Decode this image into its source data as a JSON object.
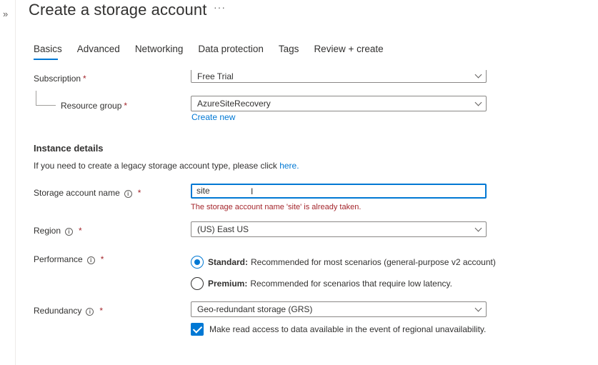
{
  "title": "Create a storage account",
  "more_icon": "ellipsis-icon",
  "expand_icon": "double-chevron-right-icon",
  "tabs": [
    {
      "label": "Basics",
      "active": true
    },
    {
      "label": "Advanced"
    },
    {
      "label": "Networking"
    },
    {
      "label": "Data protection"
    },
    {
      "label": "Tags"
    },
    {
      "label": "Review + create"
    }
  ],
  "accent_color": "#0078d4",
  "error_color": "#a4262c",
  "required_marker": "*",
  "project": {
    "subscription_label": "Subscription",
    "subscription_value": "Free Trial",
    "resource_group_label": "Resource group",
    "resource_group_value": "AzureSiteRecovery",
    "create_new": "Create new"
  },
  "instance": {
    "heading": "Instance details",
    "legacy_text": "If you need to create a legacy storage account type, please click ",
    "legacy_link": "here.",
    "name_label": "Storage account name",
    "name_value": "site",
    "name_error": "The storage account name 'site' is already taken.",
    "region_label": "Region",
    "region_value": "(US) East US",
    "performance_label": "Performance",
    "performance_options": [
      {
        "title": "Standard:",
        "desc": "Recommended for most scenarios (general-purpose v2 account)",
        "checked": true
      },
      {
        "title": "Premium:",
        "desc": "Recommended for scenarios that require low latency.",
        "checked": false
      }
    ],
    "redundancy_label": "Redundancy",
    "redundancy_value": "Geo-redundant storage (GRS)",
    "read_access_label": "Make read access to data available in the event of regional unavailability.",
    "read_access_checked": true
  }
}
